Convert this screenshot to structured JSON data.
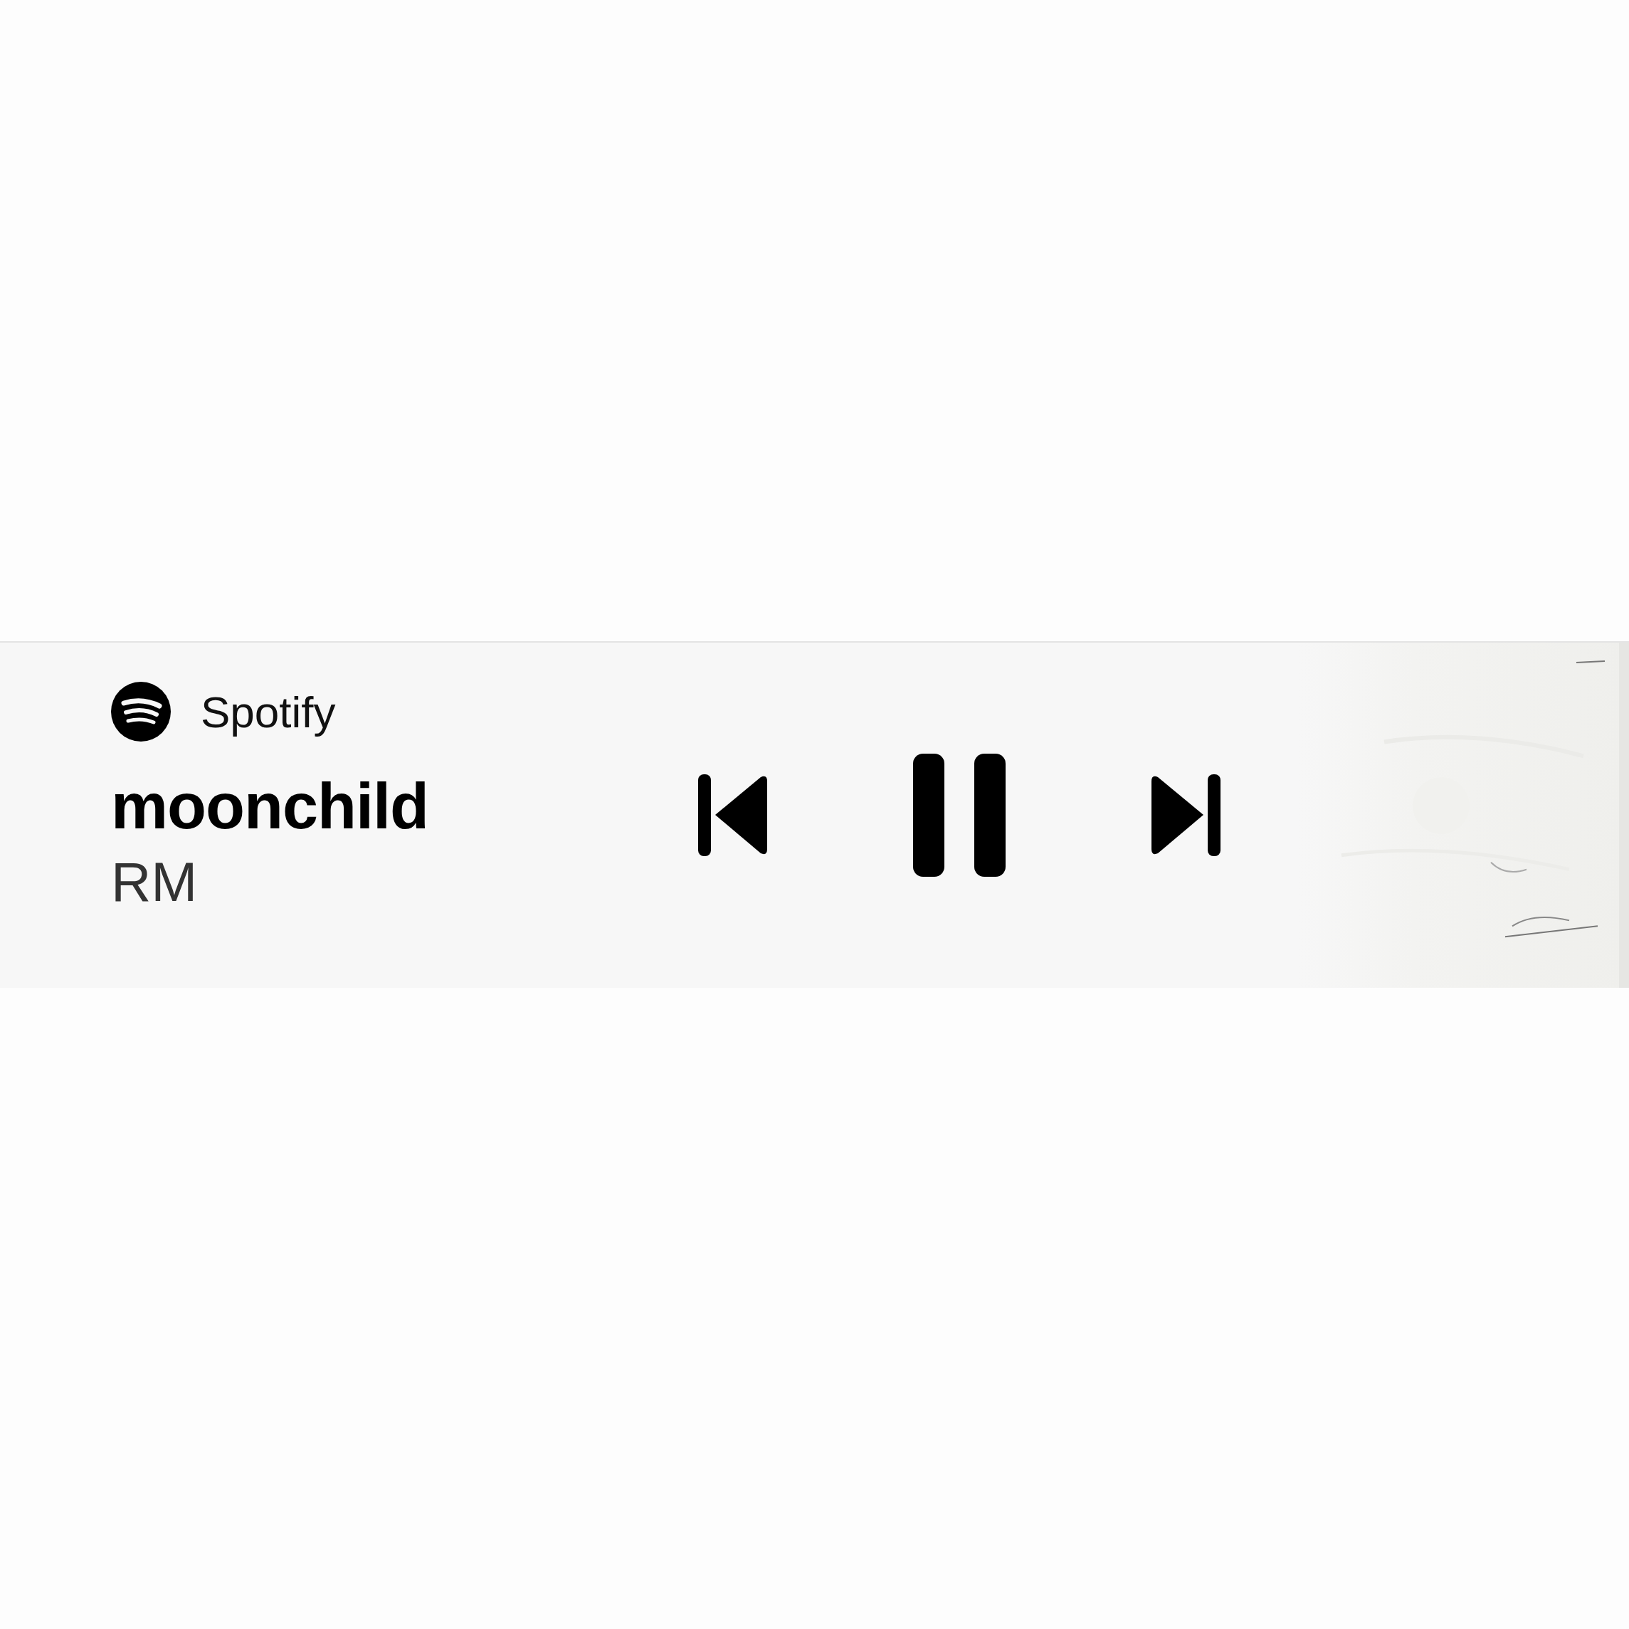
{
  "player": {
    "app_name": "Spotify",
    "title": "moonchild",
    "artist": "RM",
    "playing": true,
    "controls": [
      {
        "kind": "previous"
      },
      {
        "kind": "playpause"
      },
      {
        "kind": "next"
      }
    ]
  }
}
